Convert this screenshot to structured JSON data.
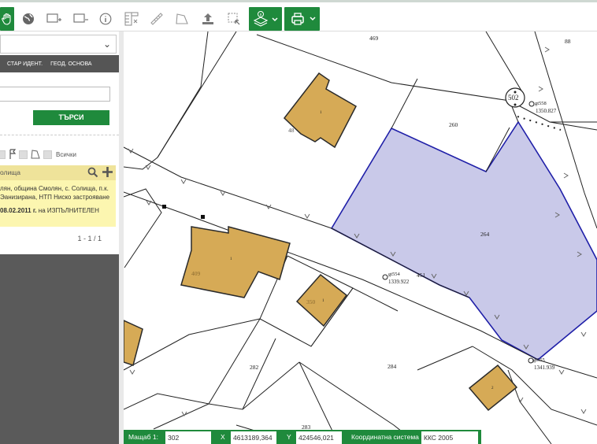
{
  "toolbar": {
    "icons": [
      "hand-pan-icon",
      "globe-icon",
      "add-window-icon",
      "remove-window-icon",
      "info-icon",
      "measure-grid-icon",
      "ruler-icon",
      "polygon-area-icon",
      "upload-icon",
      "select-area-icon",
      "layers-info-icon",
      "print-icon"
    ]
  },
  "panel": {
    "tabs": [
      "СТАР ИДЕНТ.",
      "ГЕОД. ОСНОВА"
    ],
    "search_value": "",
    "search_button": "ТЪРСИ",
    "filter_all": "Всички",
    "result_header": "олища",
    "result_line1": "лян, община Смолян, с. Солища, п.к.",
    "result_line2": "Эанизирана, НТП Ниско застрояване",
    "result_date": "08.02.2011 г.",
    "result_suffix": " на ИЗПЪЛНИТЕЛЕН",
    "pager": "1 - 1 / 1"
  },
  "map": {
    "labels": {
      "p469": "469",
      "p88": "88",
      "p502": "502",
      "gt558": "gt558",
      "gt558_value": "1350.827",
      "p260": "260",
      "p48": "48",
      "b1a": "1",
      "p264": "264",
      "gt554": "gt554",
      "gt554_value": "1339.922",
      "p451": "451",
      "p409": "409",
      "b1b": "1",
      "p350": "350",
      "b1c": "1",
      "p282": "282",
      "p284": "284",
      "gt555": "gt555",
      "gt555_value": "1341.939",
      "b2": "2",
      "p283": "283"
    },
    "colors": {
      "building": "#d6aa56",
      "selected": "#c9c9e9",
      "selected_border": "#1f1fa8"
    }
  },
  "statusbar": {
    "scale_label": "Мащаб 1:",
    "scale_value": "302",
    "x_label": "X",
    "x_value": "4613189,364",
    "y_label": "Y",
    "y_value": "424546,021",
    "crs_label": "Координатна система",
    "crs_value": "ККС 2005"
  }
}
